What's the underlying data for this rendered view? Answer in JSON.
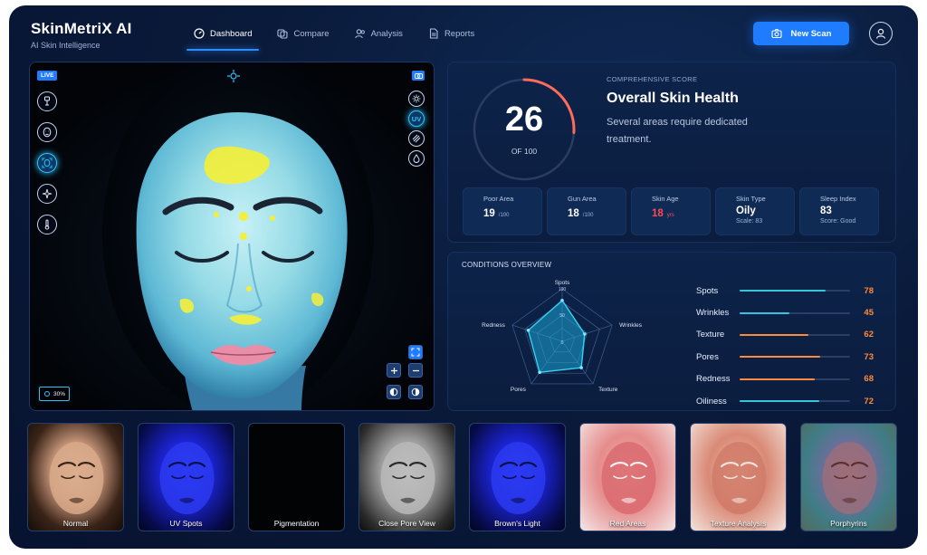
{
  "app": {
    "title": "SkinMetriX AI",
    "subtitle": "AI Skin Intelligence"
  },
  "nav": [
    {
      "label": "Dashboard",
      "icon": "gauge-icon",
      "active": true
    },
    {
      "label": "Compare",
      "icon": "compare-icon",
      "active": false
    },
    {
      "label": "Analysis",
      "icon": "users-icon",
      "active": false
    },
    {
      "label": "Reports",
      "icon": "document-icon",
      "active": false
    }
  ],
  "new_scan_label": "New Scan",
  "viewer": {
    "live_label": "LIVE",
    "zoom_label": "30%",
    "uv_label": "UV",
    "left_tools": [
      "face-probe-icon",
      "face-mesh-icon",
      "face-scan-icon",
      "sparkle-icon",
      "thermometer-icon"
    ],
    "right_tools": [
      "sun-icon",
      "uv-icon",
      "texture-lines-icon",
      "droplet-icon"
    ]
  },
  "score": {
    "value": "26",
    "of_label": "OF 100",
    "fraction": 0.26,
    "eyebrow": "COMPREHENSIVE SCORE",
    "heading": "Overall Skin Health",
    "description": "Several areas require dedicated treatment.",
    "ring_track_color": "#2a3c5f",
    "ring_accent_color": "#ff6b5a"
  },
  "metrics": [
    {
      "label": "Poor Area",
      "value": "19",
      "unit": "/100",
      "sub": "",
      "highlight": false
    },
    {
      "label": "Gun Area",
      "value": "18",
      "unit": "/100",
      "sub": "",
      "highlight": false
    },
    {
      "label": "Skin Age",
      "value": "18",
      "unit": "yrs",
      "sub": "",
      "highlight": true
    },
    {
      "label": "Skin Type",
      "value": "Oily",
      "unit": "",
      "sub": "Scale: 83",
      "highlight": false
    },
    {
      "label": "Sleep Index",
      "value": "83",
      "unit": "",
      "sub": "Score: Good",
      "highlight": false
    }
  ],
  "conditions": {
    "title": "CONDITIONS OVERVIEW",
    "radar_axes": [
      "Spots",
      "Wrinkles",
      "Texture",
      "Pores",
      "Redness"
    ],
    "radar_values": [
      78,
      45,
      62,
      73,
      68
    ],
    "radar_ticks": [
      "100",
      "50",
      "0"
    ],
    "bars": [
      {
        "label": "Spots",
        "value": 78,
        "color": "#36c6d8"
      },
      {
        "label": "Wrinkles",
        "value": 45,
        "color": "#36c6d8"
      },
      {
        "label": "Texture",
        "value": 62,
        "color": "#ff8a3d"
      },
      {
        "label": "Pores",
        "value": 73,
        "color": "#ff8a3d"
      },
      {
        "label": "Redness",
        "value": 68,
        "color": "#ff8a3d"
      },
      {
        "label": "Oiliness",
        "value": 72,
        "color": "#36c6d8"
      }
    ]
  },
  "thumbnails": [
    {
      "label": "Normal",
      "style": "normal"
    },
    {
      "label": "UV Spots",
      "style": "uv"
    },
    {
      "label": "Pigmentation",
      "style": "dark"
    },
    {
      "label": "Close Pore View",
      "style": "gray"
    },
    {
      "label": "Brown's Light",
      "style": "uv"
    },
    {
      "label": "Red Areas",
      "style": "red"
    },
    {
      "label": "Texture Analysis",
      "style": "texture"
    },
    {
      "label": "Porphyrins",
      "style": "porph"
    }
  ]
}
